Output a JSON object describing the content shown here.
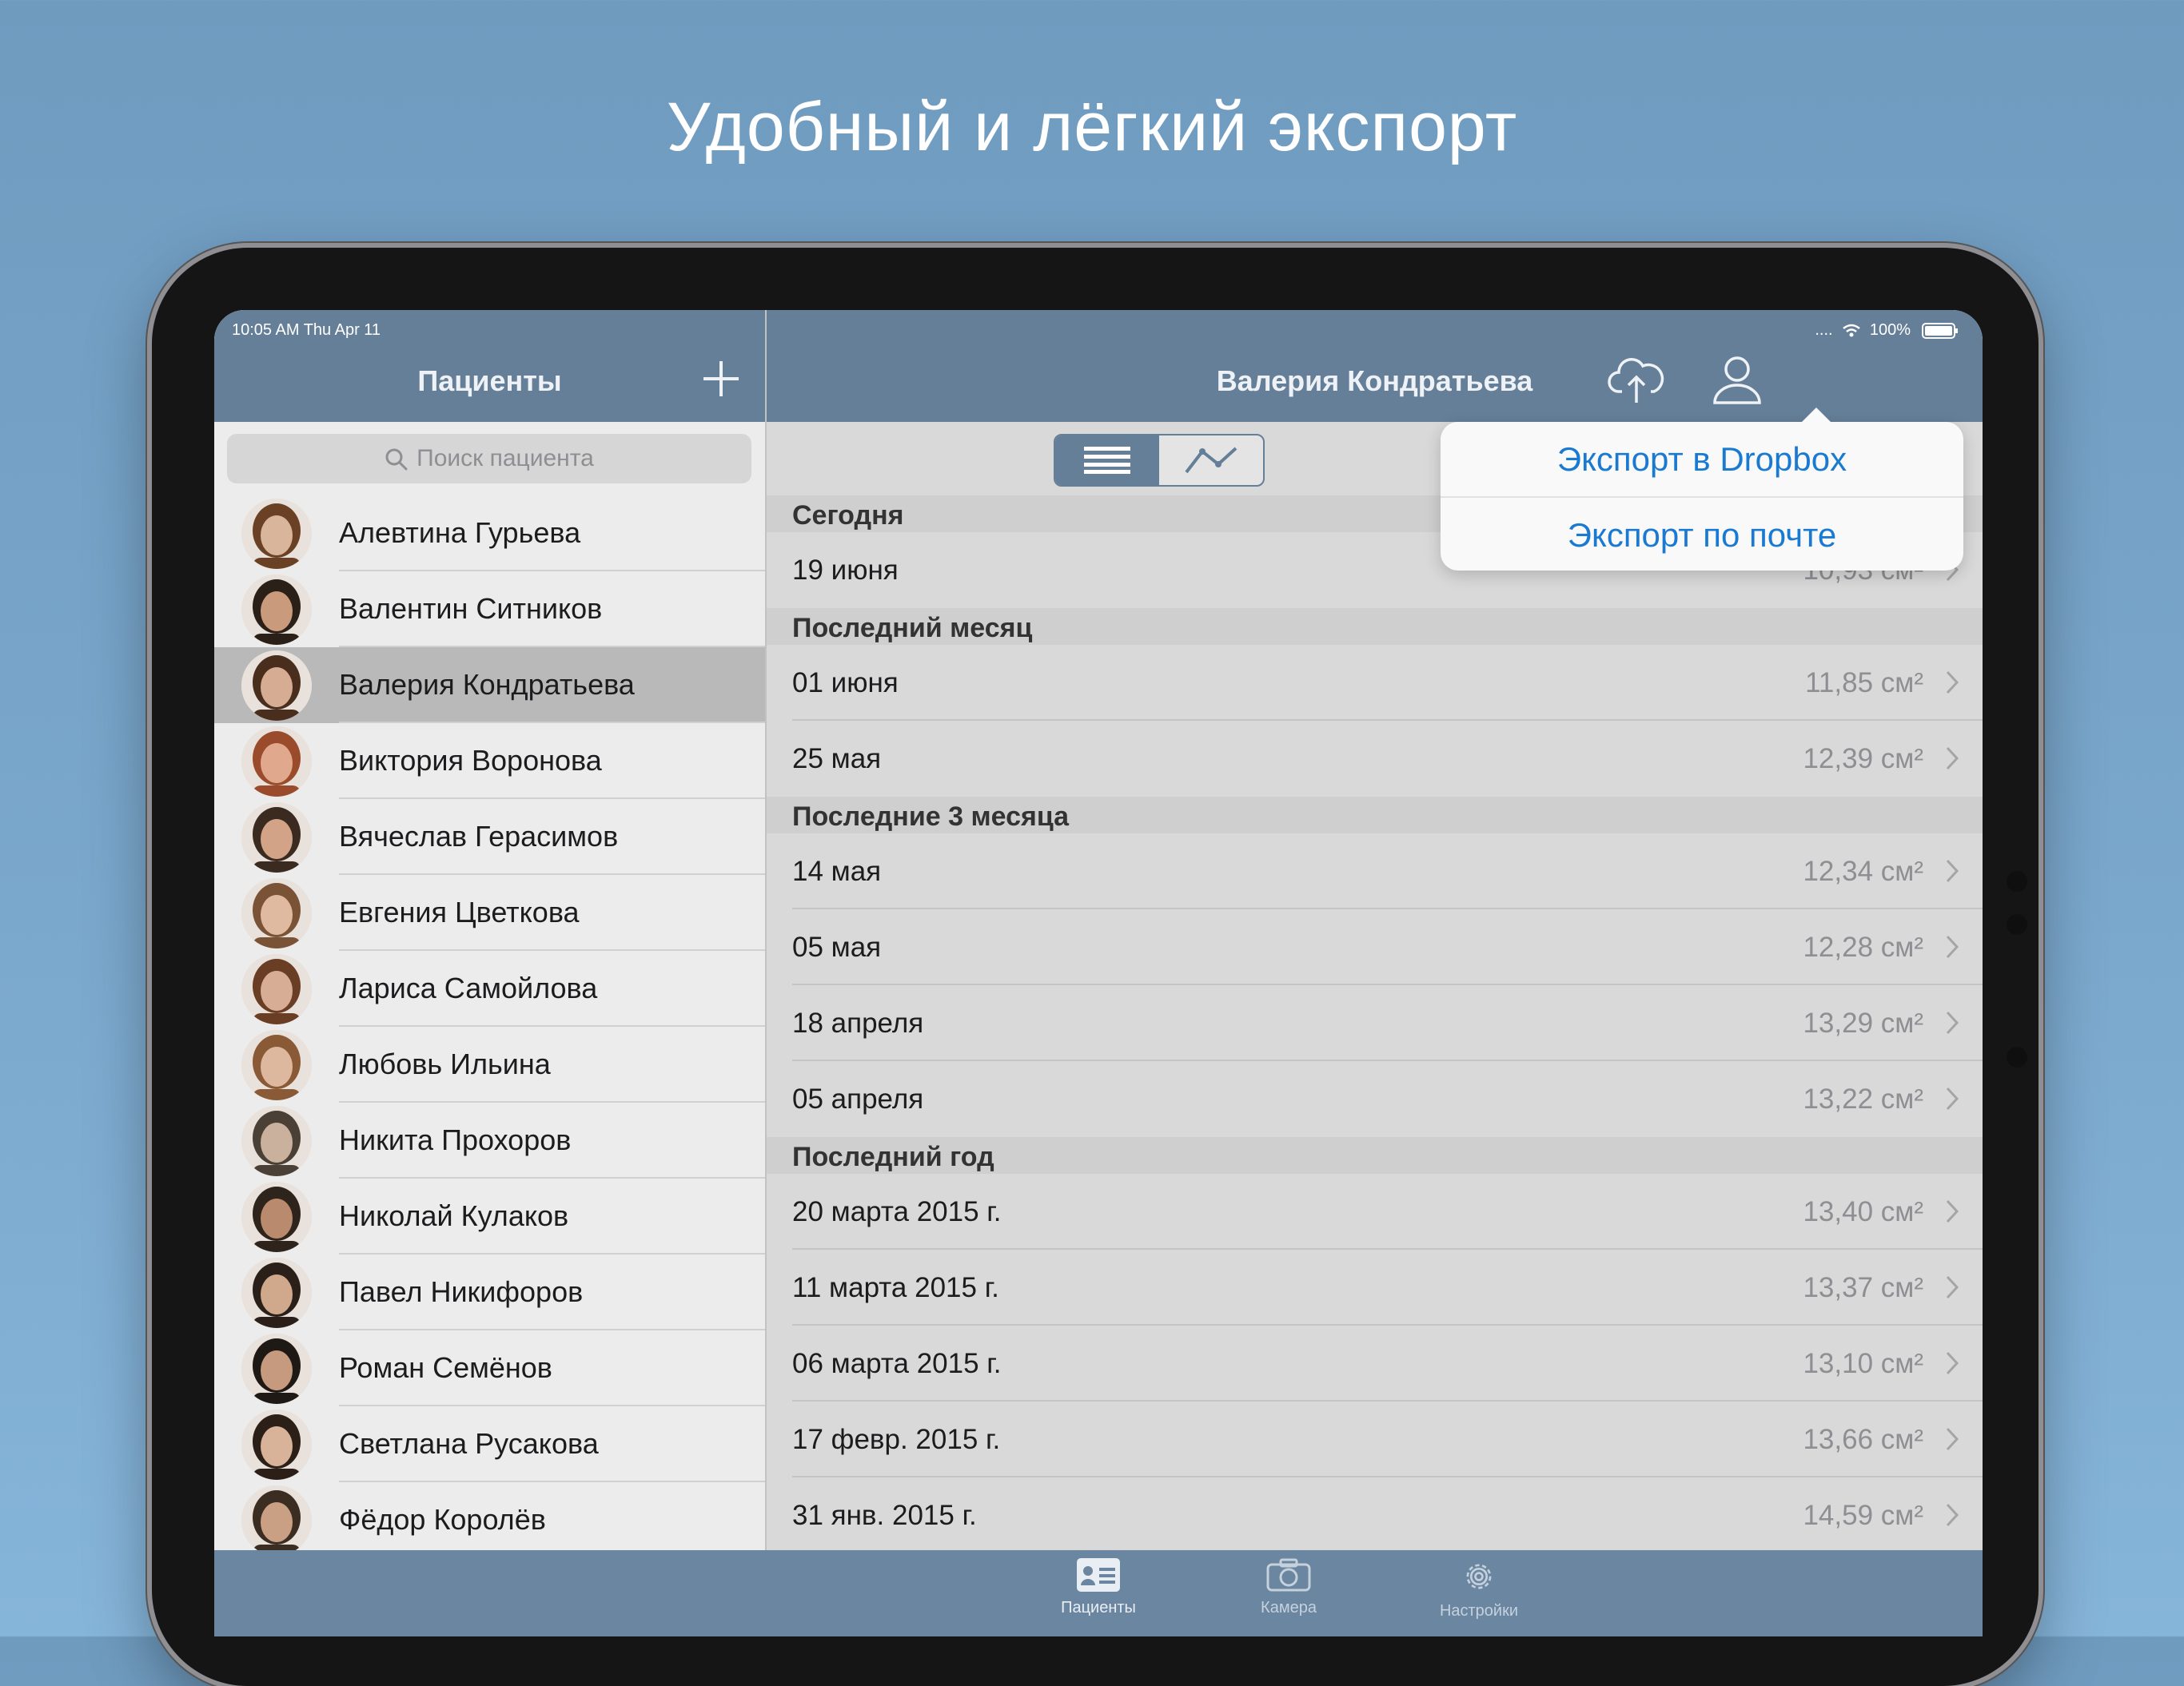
{
  "headline": "Удобный и лёгкий экспорт",
  "status_bar": {
    "time": "10:05 AM  Thu Apr 11",
    "signal": "....",
    "battery": "100%"
  },
  "master": {
    "title": "Пациенты",
    "search_placeholder": "Поиск пациента",
    "patients": [
      {
        "name": "Алевтина Гурьева",
        "selected": false,
        "avatar": {
          "skin": "#d8b59b",
          "hair": "#6b4126"
        }
      },
      {
        "name": "Валентин Ситников",
        "selected": false,
        "avatar": {
          "skin": "#c99a7c",
          "hair": "#2b2018"
        }
      },
      {
        "name": "Валерия Кондратьева",
        "selected": true,
        "avatar": {
          "skin": "#d6ad93",
          "hair": "#4a2e1d"
        }
      },
      {
        "name": "Виктория Воронова",
        "selected": false,
        "avatar": {
          "skin": "#e0a98d",
          "hair": "#9a4b2b"
        }
      },
      {
        "name": "Вячеслав Герасимов",
        "selected": false,
        "avatar": {
          "skin": "#d3a387",
          "hair": "#3a2a20"
        }
      },
      {
        "name": "Евгения Цветкова",
        "selected": false,
        "avatar": {
          "skin": "#dfb9a0",
          "hair": "#7a5236"
        }
      },
      {
        "name": "Лариса Самойлова",
        "selected": false,
        "avatar": {
          "skin": "#d7ae95",
          "hair": "#6a3e25"
        }
      },
      {
        "name": "Любовь Ильина",
        "selected": false,
        "avatar": {
          "skin": "#ddb79e",
          "hair": "#8a5a36"
        }
      },
      {
        "name": "Никита Прохоров",
        "selected": false,
        "avatar": {
          "skin": "#c9b19e",
          "hair": "#4b4036"
        }
      },
      {
        "name": "Николай Кулаков",
        "selected": false,
        "avatar": {
          "skin": "#b98a6d",
          "hair": "#2f241c"
        }
      },
      {
        "name": "Павел Никифоров",
        "selected": false,
        "avatar": {
          "skin": "#d0a88c",
          "hair": "#2a2019"
        }
      },
      {
        "name": "Роман Семёнов",
        "selected": false,
        "avatar": {
          "skin": "#c59a7e",
          "hair": "#1f1915"
        }
      },
      {
        "name": "Светлана Русакова",
        "selected": false,
        "avatar": {
          "skin": "#d9b29a",
          "hair": "#2b1f18"
        }
      },
      {
        "name": "Фёдор Королёв",
        "selected": false,
        "avatar": {
          "skin": "#caa084",
          "hair": "#3b2d22"
        }
      }
    ]
  },
  "detail": {
    "title": "Валерия Кондратьева",
    "popover": {
      "items": [
        "Экспорт в Dropbox",
        "Экспорт по почте"
      ]
    },
    "sections": [
      {
        "title": "Сегодня",
        "rows": [
          {
            "date": "19 июня",
            "value": "10,93 см²"
          }
        ]
      },
      {
        "title": "Последний месяц",
        "rows": [
          {
            "date": "01 июня",
            "value": "11,85 см²"
          },
          {
            "date": "25 мая",
            "value": "12,39 см²"
          }
        ]
      },
      {
        "title": "Последние 3 месяца",
        "rows": [
          {
            "date": "14 мая",
            "value": "12,34 см²"
          },
          {
            "date": "05 мая",
            "value": "12,28 см²"
          },
          {
            "date": "18 апреля",
            "value": "13,29 см²"
          },
          {
            "date": "05 апреля",
            "value": "13,22 см²"
          }
        ]
      },
      {
        "title": "Последний год",
        "rows": [
          {
            "date": "20 марта 2015 г.",
            "value": "13,40 см²"
          },
          {
            "date": "11 марта 2015 г.",
            "value": "13,37 см²"
          },
          {
            "date": "06 марта 2015 г.",
            "value": "13,10 см²"
          },
          {
            "date": "17 февр. 2015 г.",
            "value": "13,66 см²"
          },
          {
            "date": "31 янв. 2015 г.",
            "value": "14,59 см²"
          }
        ]
      }
    ]
  },
  "tabbar": {
    "tabs": [
      {
        "label": "Пациенты",
        "icon": "patients-card-icon",
        "active": true
      },
      {
        "label": "Камера",
        "icon": "camera-icon",
        "active": false
      },
      {
        "label": "Настройки",
        "icon": "gear-icon",
        "active": false
      }
    ]
  },
  "colors": {
    "nav": "#657f98",
    "accent_link": "#1a7ad1",
    "selected_row": "#b9b9b9"
  }
}
